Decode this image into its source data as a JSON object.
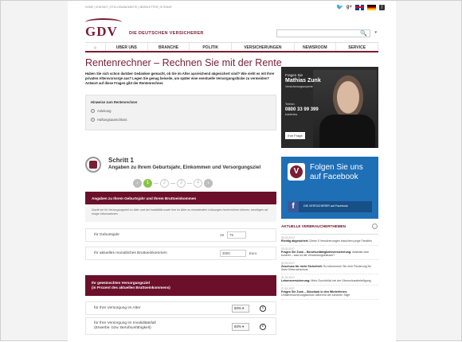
{
  "topbar": {
    "links": "HOME  |  KONTAKT  |  STELLENANGEBOTE  |  NEWSLETTER  |  SITEMAP"
  },
  "header": {
    "logo": "GDV",
    "brand": "DIE DEUTSCHEN VERSICHERER"
  },
  "nav": {
    "items": [
      "UBER UNS",
      "BRANCHE",
      "POLITIK",
      "VERSICHERUNGEN",
      "NEWSROOM",
      "SERVICE"
    ]
  },
  "main": {
    "title": "Rentenrechner – Rechnen Sie mit der Rente",
    "intro": "Haben Sie sich schon darüber Gedanken gemacht, ob Sie im Alter ausreichend abgesichert sind? Wie sieht es mit Ihrer privaten Altersvorsorge aus? Legen Sie genug beiseite, um später eine eventuelle Versorgungslücke zu vermeiden? Antwort auf diese Fragen gibt der Rentenrechner.",
    "hints": {
      "title": "Hinweise zum Rentenrechner",
      "items": [
        "Anleitung",
        "Haftungsausschluss"
      ]
    }
  },
  "promo": {
    "line1": "Fragen Sie",
    "name": "Mathias Zunk",
    "role": "Versicherungsexperte",
    "tel_label": "Telefon",
    "tel": "0800 33 99 399",
    "tel_note": "kostenlos",
    "button": "Ihre Frage"
  },
  "step": {
    "title": "Schritt 1",
    "subtitle": "Angaben zu Ihrem Geburtsjahr, Einkommen und Versorgungsziel",
    "pages": [
      "1",
      "2",
      "3",
      "4"
    ]
  },
  "section1": {
    "bar": "Angaben zu Ihrem Geburtsjahr und Ihrem Bruttoeinkommen",
    "note": "Damit wir Ihr Versorgungsziel im Alter und bei Invalidität sowie Ihre im Alter zu erwartenden Leistungen hochrechnen können, benötigen wir einige Informationen.",
    "birth_label": "Ihr Geburtsjahr",
    "birth_prefix": "19",
    "birth_value": "75",
    "income_label": "Ihr aktuelles monatliches Bruttoeinkommen",
    "income_value": "3000",
    "income_unit": "Euro"
  },
  "section2": {
    "bar_line1": "Ihr gewünschtes Versorgungsziel",
    "bar_line2": "(in Prozent des aktuellen Bruttoeinkommens)",
    "age_label": "für Ihre Versorgung im Alter",
    "age_value": "60% ▾",
    "inv_label1": "für Ihre Versorgung im Invaliditätsfall",
    "inv_label2": "(Erwerbs- bzw. Berufsunfähigkeit)",
    "inv_value": "60% ▾"
  },
  "facebook": {
    "line1": "Folgen Sie uns",
    "line2": "auf Facebook",
    "badge": "DIE VERSICHERER auf Facebook"
  },
  "news": {
    "heading": "AKTUELLE VERBRAUCHERTHEMEN",
    "items": [
      {
        "date": "06.02.2017",
        "bold": "Richtig abgesichert:",
        "text": " Diese 5 Versicherungen brauchen junge Familien"
      },
      {
        "date": "03.02.2017",
        "bold": "Fragen Sie Zunk – Berufsunfähigkeitsversicherung:",
        "text": " Abstrakt oder konkret – was ist die Verweisungsklausel?"
      },
      {
        "date": "02.02.2017",
        "bold": "Zuschuss für mehr Sicherheit:",
        "text": " So bekommen Sie eine Förderung für Ihren Einbruchschutz"
      },
      {
        "date": "31.01.2017",
        "bold": "Lebensversicherung:",
        "text": " Mehr Durchblick bei der Überschussbeteiligung"
      },
      {
        "date": "27.01.2017",
        "bold": "Fragen Sie Zunk – Skiurlaub in den Winterferien:",
        "text": " Unfallversicherungsschutz während der schönen Tage"
      }
    ]
  }
}
